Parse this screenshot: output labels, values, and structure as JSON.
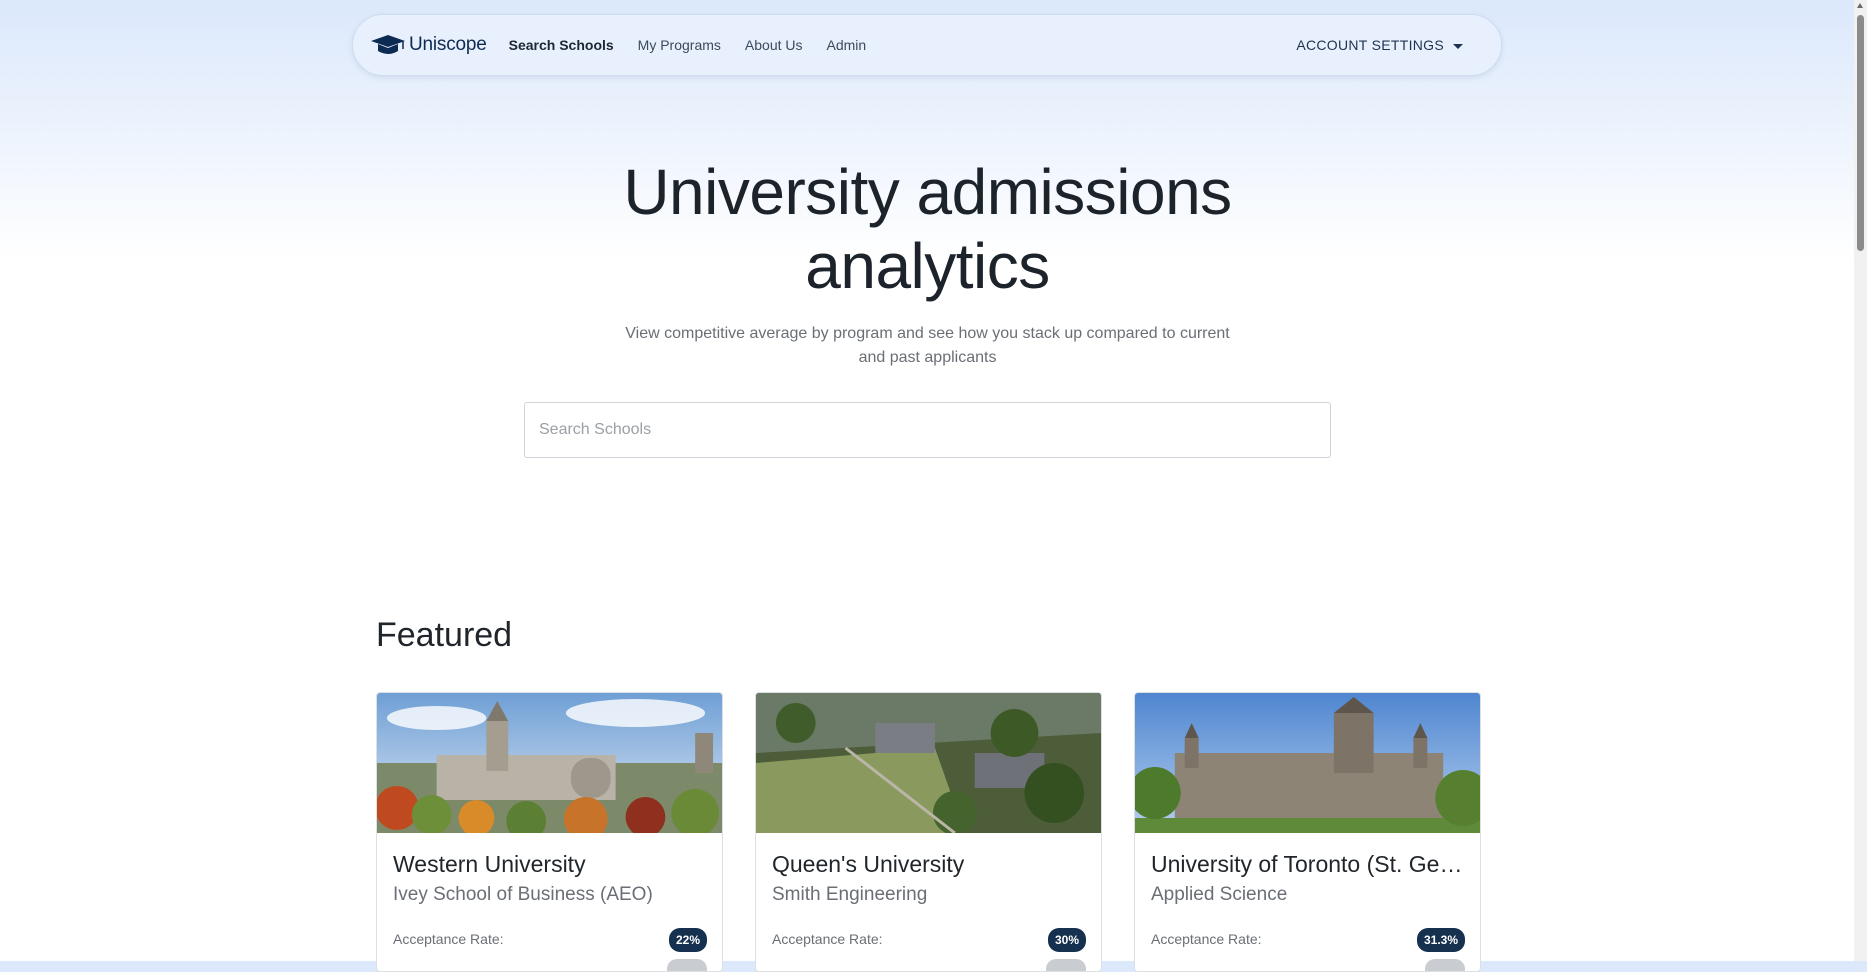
{
  "nav": {
    "brand": "Uniscope",
    "links": [
      {
        "label": "Search Schools",
        "active": true
      },
      {
        "label": "My Programs",
        "active": false
      },
      {
        "label": "About Us",
        "active": false
      },
      {
        "label": "Admin",
        "active": false
      }
    ],
    "account_label": "ACCOUNT SETTINGS"
  },
  "hero": {
    "title_line1": "University admissions",
    "title_line2": "analytics",
    "subtitle_line1": "View competitive average by program and see how you stack up compared to current",
    "subtitle_line2": "and past applicants",
    "search_placeholder": "Search Schools"
  },
  "featured": {
    "heading": "Featured",
    "rate_label": "Acceptance Rate:",
    "cards": [
      {
        "school": "Western University",
        "program": "Ivey School of Business (AEO)",
        "acceptance_rate": "22%"
      },
      {
        "school": "Queen's University",
        "program": "Smith Engineering",
        "acceptance_rate": "30%"
      },
      {
        "school": "University of Toronto (St. George)",
        "program": "Applied Science",
        "acceptance_rate": "31.3%"
      }
    ]
  },
  "colors": {
    "brand": "#0d2b52",
    "badge": "#16304f"
  }
}
